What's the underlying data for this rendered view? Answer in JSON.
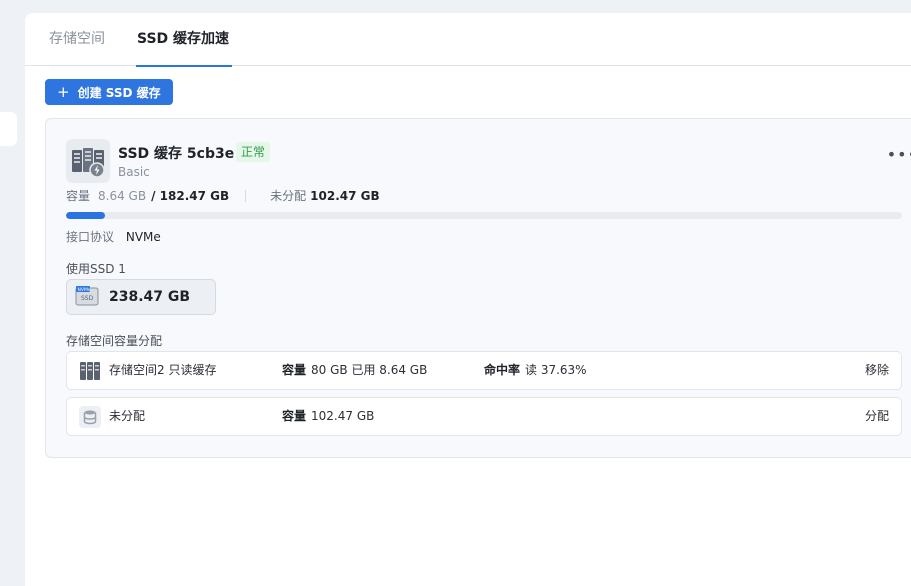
{
  "tabs": [
    {
      "label": "存储空间"
    },
    {
      "label": "SSD 缓存加速"
    }
  ],
  "create_button": {
    "icon": "plus-icon",
    "label": "创建 SSD 缓存"
  },
  "cache": {
    "title": "SSD 缓存 5cb3e",
    "status": "正常",
    "type": "Basic",
    "capacity_label": "容量",
    "used": "8.64 GB",
    "total": "/ 182.47 GB",
    "unallocated_label": "未分配",
    "unallocated": "102.47 GB",
    "usage_fraction": 0.047,
    "protocol_label": "接口协议",
    "protocol": "NVMe",
    "ssd_label": "使用SSD 1",
    "ssd_size": "238.47 GB",
    "ssd_icon_text": "NVMe",
    "alloc_label": "存储空间容量分配",
    "allocations": [
      {
        "name": "存储空间2  只读缓存",
        "cap_label": "容量",
        "cap": "80 GB  已用 8.64 GB",
        "hit_label": "命中率",
        "hit": "读 37.63%",
        "action": "移除"
      },
      {
        "name": "未分配",
        "cap_label": "容量",
        "cap": "102.47 GB",
        "action": "分配"
      }
    ]
  },
  "colors": {
    "accent": "#2f75e0",
    "status_ok": "#2e9e4b"
  }
}
